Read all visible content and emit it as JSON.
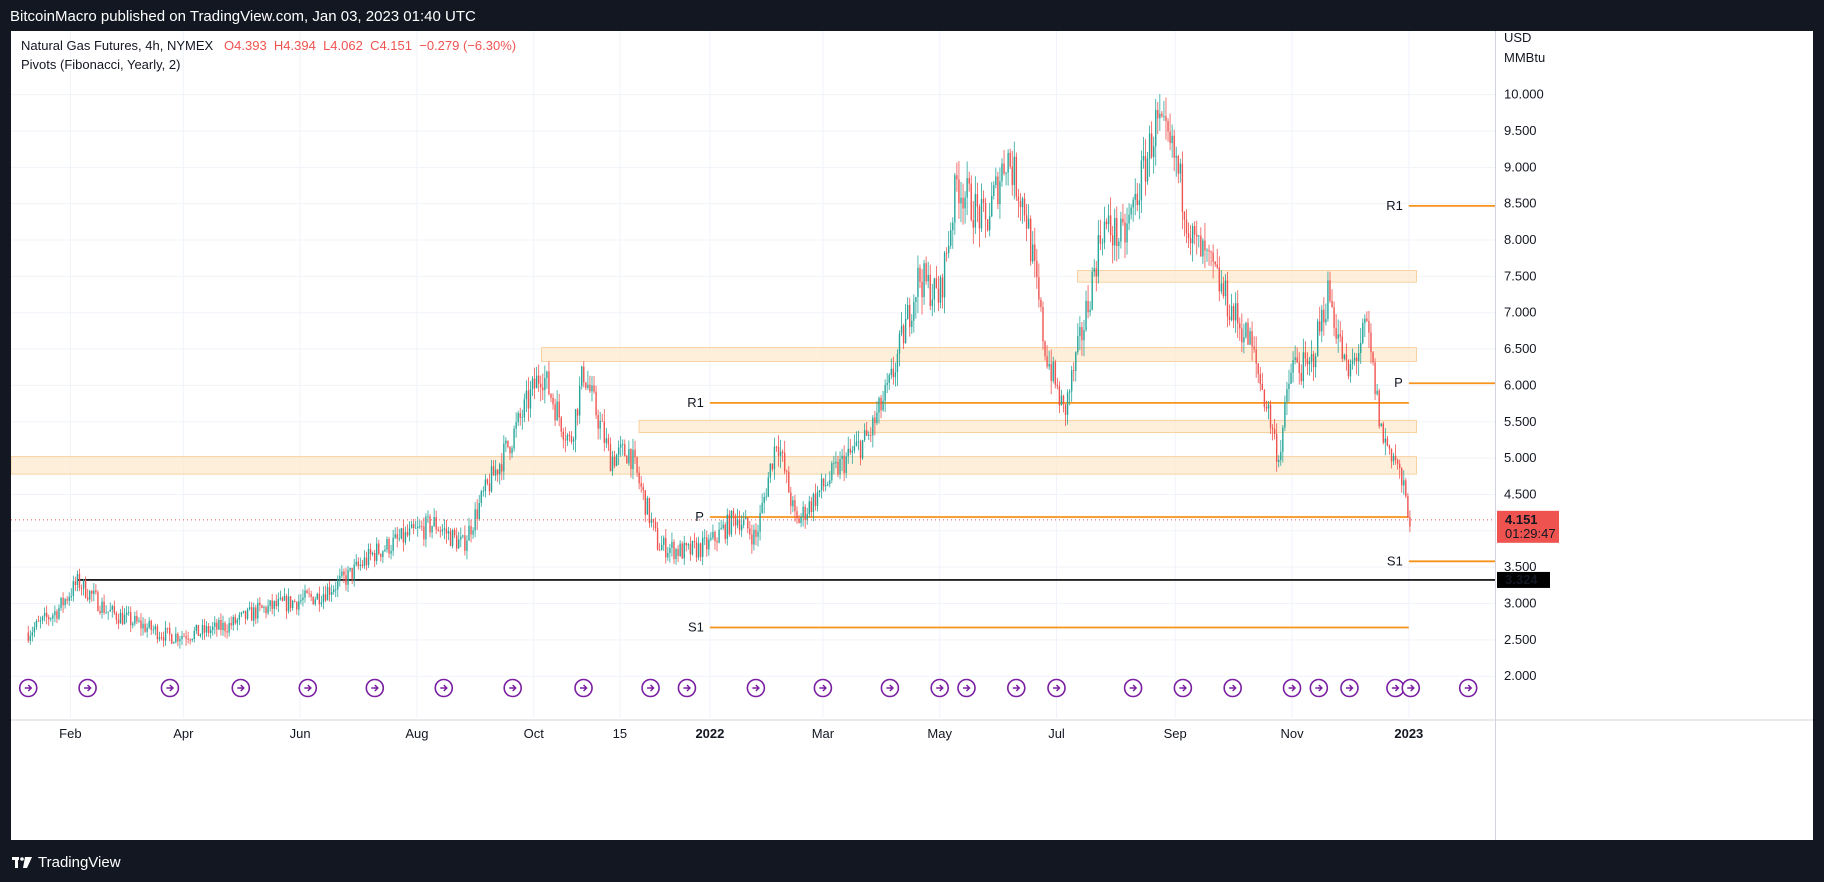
{
  "publish_line": "BitcoinMacro published on TradingView.com, Jan 03, 2023 01:40 UTC",
  "footer": {
    "brand": "TradingView"
  },
  "colors": {
    "up": "#26a69a",
    "down": "#ef5350",
    "pivot": "#f7931a",
    "zone_fill": "#fde9cf",
    "support_line": "#000000",
    "price_label_bg": "#ef5350"
  },
  "chart_data": {
    "type": "candlestick",
    "title": "Natural Gas Futures, 4h, NYMEX",
    "ohlc": {
      "O": "O4.393",
      "H": "H4.394",
      "L": "L4.062",
      "C": "C4.151",
      "change": "−0.279 (−6.30%)"
    },
    "indicator": "Pivots (Fibonacci, Yearly, 2)",
    "currency_label": "USD",
    "unit_label": "MMBtu",
    "ylim": [
      1.7,
      10.6
    ],
    "y_ticks": [
      "2.000",
      "2.500",
      "3.000",
      "3.500",
      "4.000",
      "4.500",
      "5.000",
      "5.500",
      "6.000",
      "6.500",
      "7.000",
      "7.500",
      "8.000",
      "8.500",
      "9.000",
      "9.500",
      "10.000"
    ],
    "x_ticks": [
      {
        "label": "Feb",
        "date": "2021-02-01",
        "bold": false
      },
      {
        "label": "Apr",
        "date": "2021-04-01",
        "bold": false
      },
      {
        "label": "Jun",
        "date": "2021-06-01",
        "bold": false
      },
      {
        "label": "Aug",
        "date": "2021-08-01",
        "bold": false
      },
      {
        "label": "Oct",
        "date": "2021-10-01",
        "bold": false
      },
      {
        "label": "15",
        "date": "2021-11-15",
        "bold": false
      },
      {
        "label": "2022",
        "date": "2022-01-01",
        "bold": true
      },
      {
        "label": "Mar",
        "date": "2022-03-01",
        "bold": false
      },
      {
        "label": "May",
        "date": "2022-05-01",
        "bold": false
      },
      {
        "label": "Jul",
        "date": "2022-07-01",
        "bold": false
      },
      {
        "label": "Sep",
        "date": "2022-09-01",
        "bold": false
      },
      {
        "label": "Nov",
        "date": "2022-11-01",
        "bold": false
      },
      {
        "label": "2023",
        "date": "2023-01-01",
        "bold": true
      }
    ],
    "price_path": [
      [
        "2021-01-10",
        2.6
      ],
      [
        "2021-01-25",
        2.9
      ],
      [
        "2021-02-05",
        3.3
      ],
      [
        "2021-02-20",
        2.9
      ],
      [
        "2021-03-10",
        2.7
      ],
      [
        "2021-03-25",
        2.55
      ],
      [
        "2021-04-10",
        2.6
      ],
      [
        "2021-04-25",
        2.7
      ],
      [
        "2021-05-10",
        2.9
      ],
      [
        "2021-05-25",
        3.0
      ],
      [
        "2021-06-10",
        3.1
      ],
      [
        "2021-06-25",
        3.35
      ],
      [
        "2021-07-10",
        3.7
      ],
      [
        "2021-07-25",
        3.9
      ],
      [
        "2021-08-10",
        4.1
      ],
      [
        "2021-08-25",
        3.8
      ],
      [
        "2021-09-05",
        4.5
      ],
      [
        "2021-09-20",
        5.3
      ],
      [
        "2021-10-05",
        6.2
      ],
      [
        "2021-10-20",
        5.2
      ],
      [
        "2021-10-27",
        6.2
      ],
      [
        "2021-11-10",
        5.0
      ],
      [
        "2021-11-20",
        5.1
      ],
      [
        "2021-12-05",
        3.8
      ],
      [
        "2021-12-20",
        3.7
      ],
      [
        "2021-12-31",
        3.8
      ],
      [
        "2022-01-15",
        4.2
      ],
      [
        "2022-01-25",
        3.9
      ],
      [
        "2022-02-05",
        5.3
      ],
      [
        "2022-02-15",
        4.1
      ],
      [
        "2022-03-01",
        4.6
      ],
      [
        "2022-03-10",
        4.9
      ],
      [
        "2022-03-25",
        5.3
      ],
      [
        "2022-04-05",
        6.0
      ],
      [
        "2022-04-20",
        7.5
      ],
      [
        "2022-05-01",
        7.2
      ],
      [
        "2022-05-10",
        8.8
      ],
      [
        "2022-05-25",
        8.2
      ],
      [
        "2022-06-05",
        9.2
      ],
      [
        "2022-06-15",
        8.4
      ],
      [
        "2022-06-25",
        6.5
      ],
      [
        "2022-07-05",
        5.6
      ],
      [
        "2022-07-15",
        6.8
      ],
      [
        "2022-07-25",
        8.2
      ],
      [
        "2022-08-05",
        8.0
      ],
      [
        "2022-08-15",
        8.9
      ],
      [
        "2022-08-22",
        9.6
      ],
      [
        "2022-09-01",
        9.1
      ],
      [
        "2022-09-10",
        8.0
      ],
      [
        "2022-09-20",
        7.6
      ],
      [
        "2022-10-01",
        7.0
      ],
      [
        "2022-10-10",
        6.6
      ],
      [
        "2022-10-20",
        5.6
      ],
      [
        "2022-10-25",
        5.0
      ],
      [
        "2022-11-01",
        6.3
      ],
      [
        "2022-11-10",
        6.2
      ],
      [
        "2022-11-20",
        7.3
      ],
      [
        "2022-11-30",
        6.1
      ],
      [
        "2022-12-10",
        6.8
      ],
      [
        "2022-12-18",
        5.3
      ],
      [
        "2022-12-25",
        5.0
      ],
      [
        "2023-01-02",
        4.15
      ]
    ],
    "current_price": "4.151",
    "countdown": "01:29:47",
    "support_level": {
      "value": 3.324,
      "label": "3.324",
      "start": "2021-02-05"
    },
    "zones": [
      {
        "from": "2021-01-01",
        "to": "2023-01-05",
        "low": 4.78,
        "high": 5.02
      },
      {
        "from": "2021-11-25",
        "to": "2023-01-05",
        "low": 5.35,
        "high": 5.52
      },
      {
        "from": "2021-10-05",
        "to": "2023-01-05",
        "low": 6.33,
        "high": 6.52
      },
      {
        "from": "2022-07-12",
        "to": "2023-01-05",
        "low": 7.42,
        "high": 7.58
      }
    ],
    "pivot_lines_2022": [
      {
        "label": "R1",
        "value": 5.76,
        "from": "2022-01-01",
        "to": "2023-01-01"
      },
      {
        "label": "P",
        "value": 4.19,
        "from": "2022-01-01",
        "to": "2023-01-01"
      },
      {
        "label": "S1",
        "value": 2.67,
        "from": "2022-01-01",
        "to": "2023-01-01"
      }
    ],
    "pivot_lines_2023": [
      {
        "label": "R1",
        "value": 8.47,
        "from": "2023-01-01",
        "to": "2023-02-15"
      },
      {
        "label": "P",
        "value": 6.03,
        "from": "2023-01-01",
        "to": "2023-02-15"
      },
      {
        "label": "S1",
        "value": 3.58,
        "from": "2023-01-01",
        "to": "2023-02-15"
      }
    ],
    "event_markers": [
      "2021-01-10",
      "2021-02-10",
      "2021-03-25",
      "2021-05-01",
      "2021-06-05",
      "2021-07-10",
      "2021-08-15",
      "2021-09-20",
      "2021-10-27",
      "2021-12-01",
      "2021-12-20",
      "2022-01-25",
      "2022-03-01",
      "2022-04-05",
      "2022-05-01",
      "2022-05-15",
      "2022-06-10",
      "2022-07-01",
      "2022-08-10",
      "2022-09-05",
      "2022-10-01",
      "2022-11-01",
      "2022-11-15",
      "2022-12-01",
      "2022-12-25",
      "2023-01-02",
      "2023-02-01"
    ]
  }
}
